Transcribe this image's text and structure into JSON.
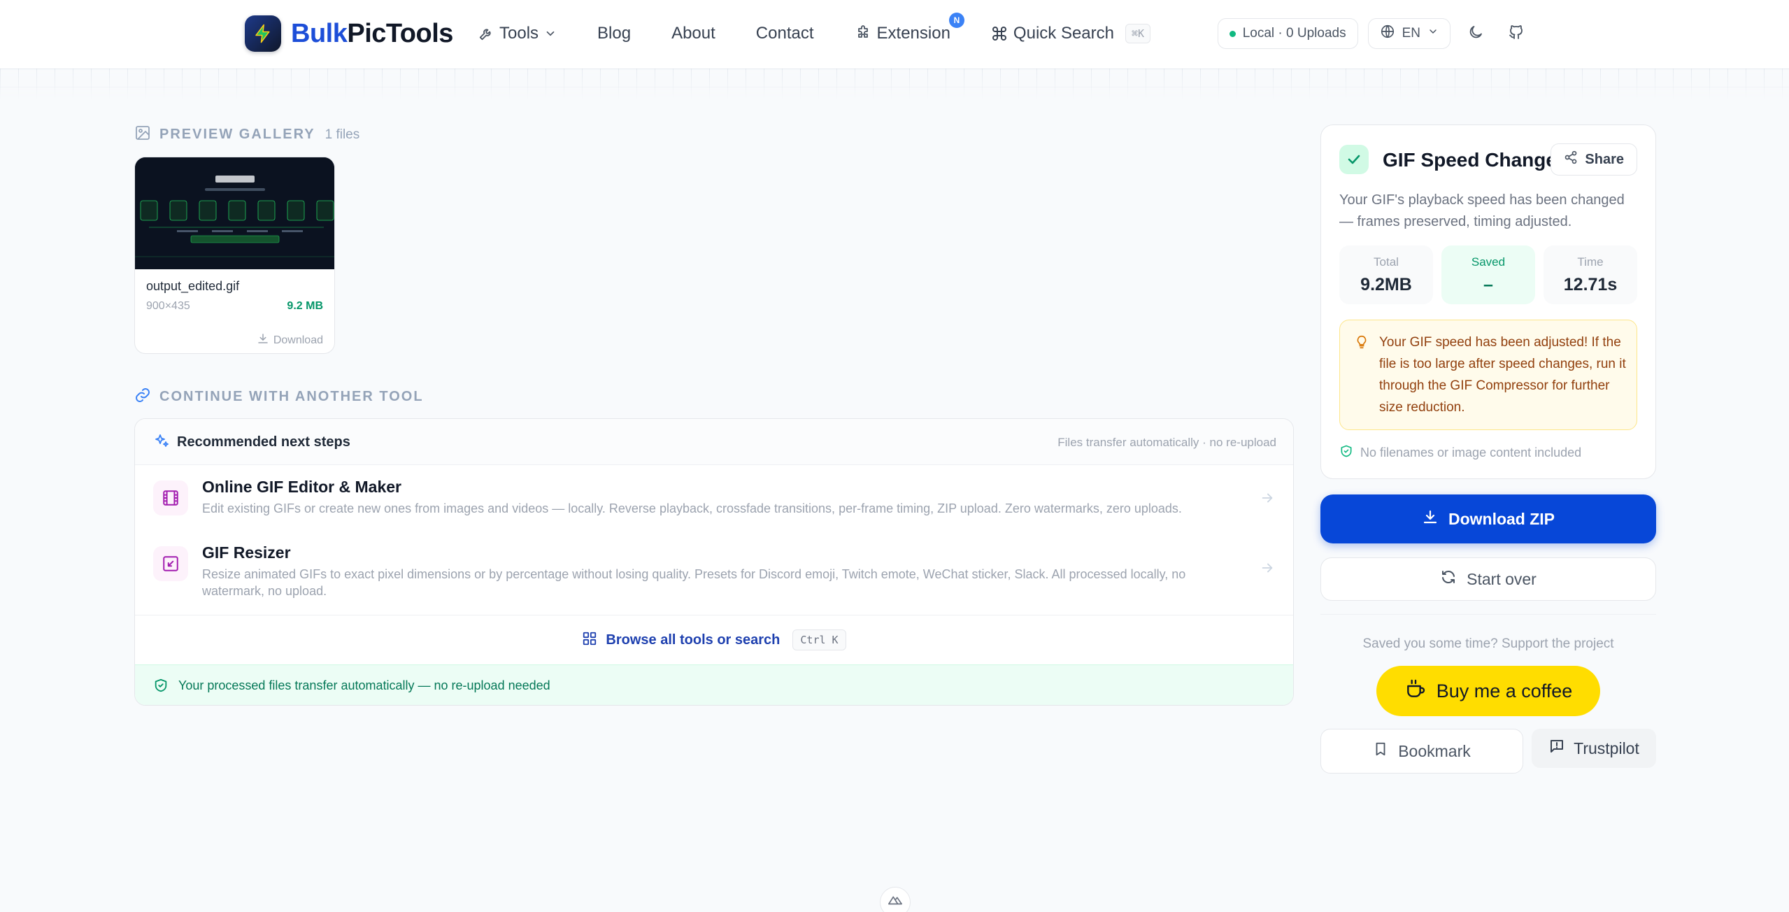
{
  "header": {
    "brand_part1": "Bulk",
    "brand_part2": "PicTools",
    "nav": {
      "tools": "Tools",
      "blog": "Blog",
      "about": "About",
      "contact": "Contact",
      "extension": "Extension",
      "extension_badge": "N",
      "quick_search": "Quick Search",
      "quick_search_shortcut": "⌘K"
    },
    "status": "Local · 0 Uploads",
    "language": "EN"
  },
  "gallery": {
    "title": "PREVIEW GALLERY",
    "count": "1 files",
    "file": {
      "name": "output_edited.gif",
      "dimensions": "900×435",
      "size": "9.2 MB",
      "download_label": "Download"
    }
  },
  "continue": {
    "title": "CONTINUE WITH ANOTHER TOOL",
    "panel_title": "Recommended next steps",
    "panel_note": "Files transfer automatically · no re-upload",
    "tools": [
      {
        "name": "Online GIF Editor & Maker",
        "description": "Edit existing GIFs or create new ones from images and videos — locally. Reverse playback, crossfade transitions, per-frame timing, ZIP upload. Zero watermarks, zero uploads."
      },
      {
        "name": "GIF Resizer",
        "description": "Resize animated GIFs to exact pixel dimensions or by percentage without losing quality. Presets for Discord emoji, Twitch emote, WeChat sticker, Slack. All processed locally, no watermark, no upload."
      }
    ],
    "browse_label": "Browse all tools or search",
    "browse_shortcut": "Ctrl K",
    "footer_note": "Your processed files transfer automatically — no re-upload needed"
  },
  "result": {
    "title": "GIF Speed Changer",
    "share_label": "Share",
    "description": "Your GIF's playback speed has been changed — frames preserved, timing adjusted.",
    "stats": {
      "total_label": "Total",
      "total_value": "9.2MB",
      "saved_label": "Saved",
      "saved_value": "–",
      "time_label": "Time",
      "time_value": "12.71s"
    },
    "tip": "Your GIF speed has been adjusted! If the file is too large after speed changes, run it through the GIF Compressor for further size reduction.",
    "privacy": "No filenames or image content included"
  },
  "actions": {
    "download_zip": "Download ZIP",
    "start_over": "Start over",
    "support_text": "Saved you some time? Support the project",
    "coffee": "Buy me a coffee",
    "bookmark": "Bookmark",
    "trustpilot": "Trustpilot"
  },
  "colors": {
    "brand_blue": "#1d4ed8",
    "download_button": "#0747d8",
    "coffee_yellow": "#ffdd00",
    "success_green": "#059669",
    "tip_amber": "#92400e"
  }
}
